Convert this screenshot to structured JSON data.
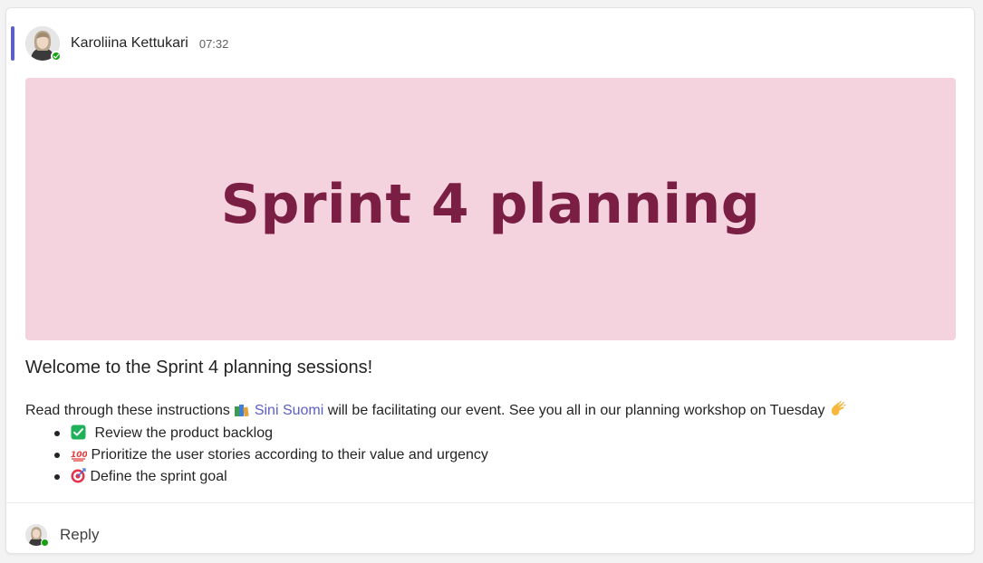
{
  "message": {
    "sender_name": "Karoliina Kettukari",
    "timestamp": "07:32",
    "accent_color": "#5b5fc7",
    "presence_status": "available",
    "banner": {
      "title": "Sprint 4 planning",
      "background_color": "#f5d3de",
      "text_color": "#7a1e44"
    },
    "headline": "Welcome to the Sprint 4 planning sessions!",
    "body": {
      "intro": "Read through these instructions",
      "intro_emoji": "books-emoji",
      "mention": "Sini Suomi",
      "after_mention": "will be facilitating our event. See you all in our planning workshop on Tuesday",
      "end_emoji": "clapping-hands-emoji"
    },
    "checklist": [
      {
        "emoji": "check-mark-button-emoji",
        "text": "Review the product backlog"
      },
      {
        "emoji": "hundred-points-emoji",
        "text": "Prioritize the user stories according to their value and urgency"
      },
      {
        "emoji": "direct-hit-emoji",
        "text": "Define the sprint goal"
      }
    ]
  },
  "reply": {
    "label": "Reply"
  }
}
